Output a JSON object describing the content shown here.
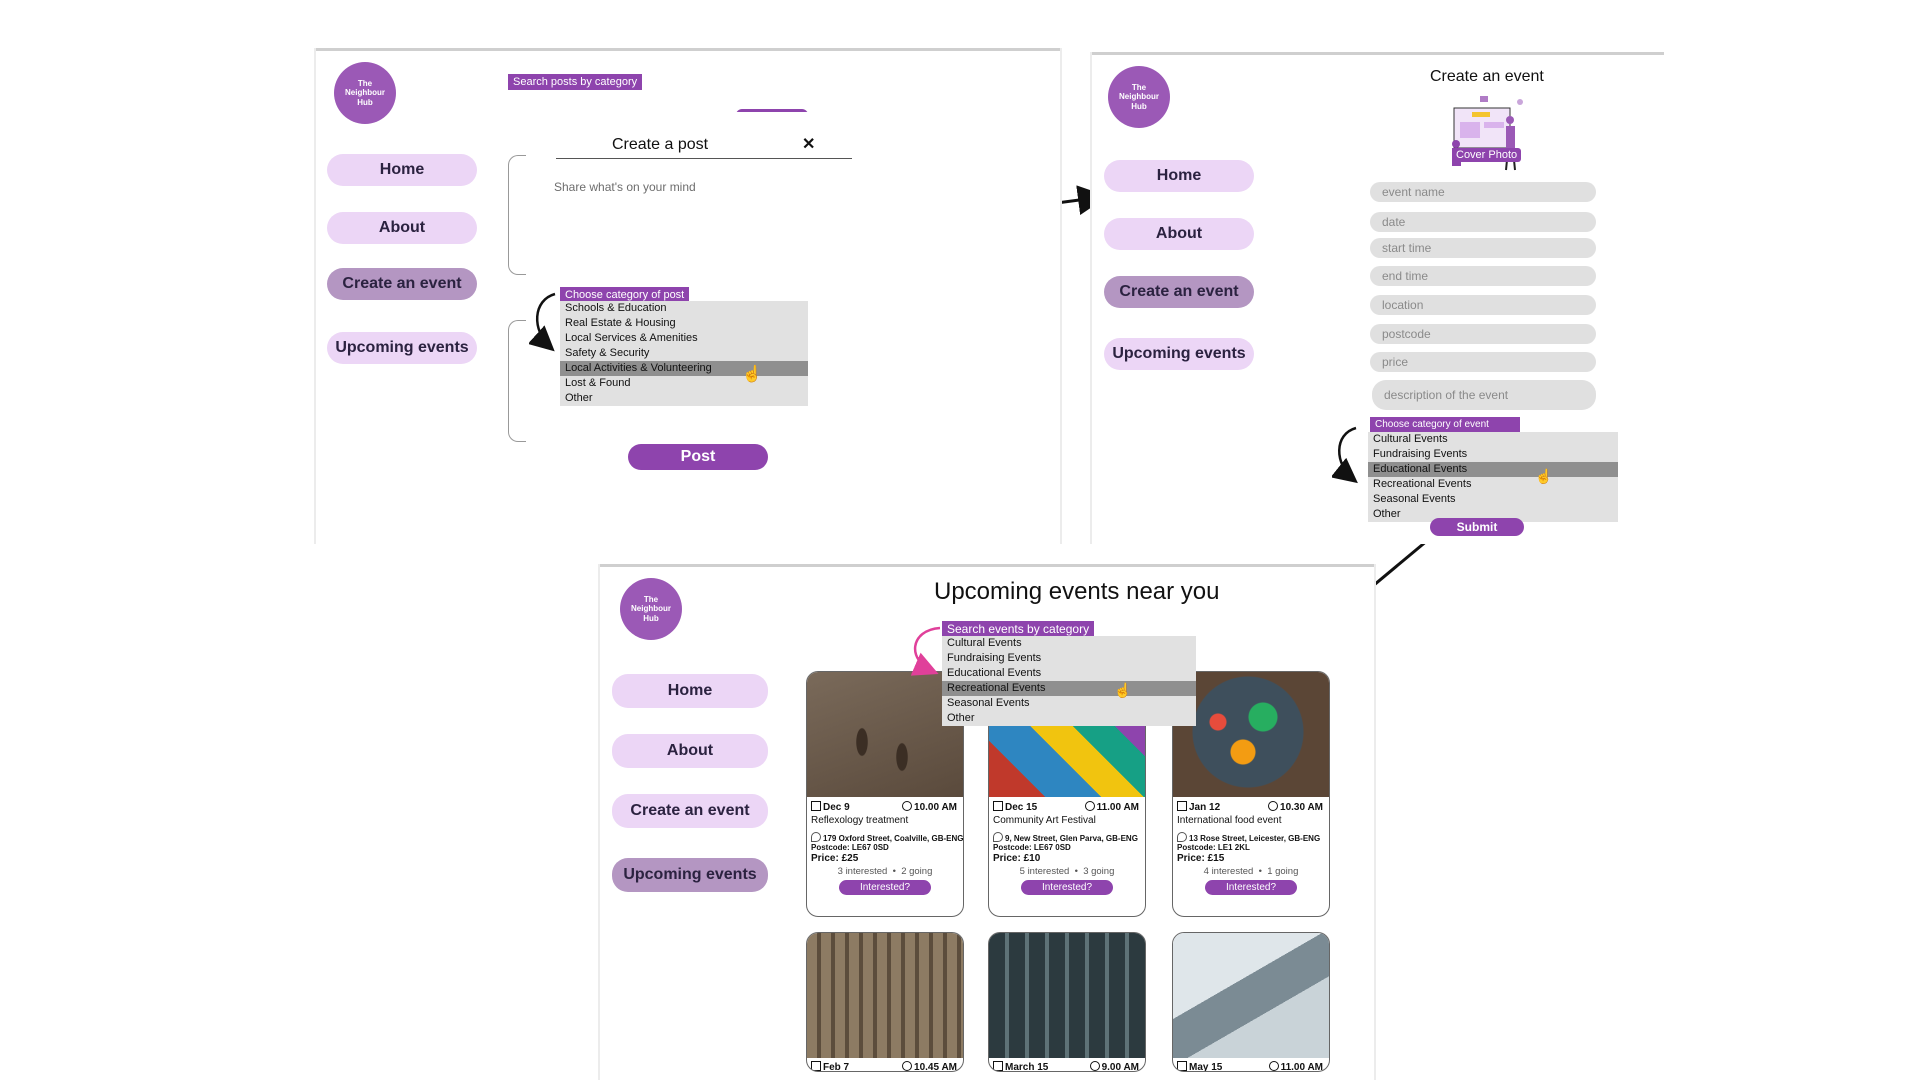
{
  "brand": {
    "logo_text": "The Neighbour Hub"
  },
  "nav": {
    "home": "Home",
    "about": "About",
    "create": "Create an event",
    "upcoming": "Upcoming events"
  },
  "panel_post": {
    "search_tag": "Search posts by category",
    "modal_title": "Create a post",
    "close": "✕",
    "placeholder": "Share what's on your mind",
    "category_label": "Choose category of post",
    "categories": [
      "Schools & Education",
      "Real Estate & Housing",
      "Local Services & Amenities",
      "Safety & Security",
      "Local Activities & Volunteering",
      "Lost & Found",
      "Other"
    ],
    "highlighted_index": 4,
    "post_button": "Post"
  },
  "panel_create": {
    "title": "Create an event",
    "cover_label": "Cover Photo",
    "fields": [
      "event name",
      "date",
      "start time",
      "end time",
      "location",
      "postcode",
      "price",
      "description of the event"
    ],
    "category_label": "Choose category of event",
    "categories": [
      "Cultural Events",
      "Fundraising Events",
      "Educational Events",
      "Recreational Events",
      "Seasonal Events",
      "Other"
    ],
    "highlighted_index": 2,
    "submit_button": "Submit"
  },
  "panel_upcoming": {
    "title": "Upcoming events near you",
    "search_tag": "Search events by category",
    "categories": [
      "Cultural Events",
      "Fundraising Events",
      "Educational Events",
      "Recreational Events",
      "Seasonal Events",
      "Other"
    ],
    "highlighted_index": 3,
    "events": [
      {
        "date": "Dec 9",
        "time": "10.00 AM",
        "title": "Reflexology treatment",
        "address": "179 Oxford Street, Coalville, GB-ENG",
        "postcode": "Postcode: LE67 0SD",
        "price": "Price: £25",
        "interested": "3 interested",
        "going": "2 going",
        "button": "Interested?"
      },
      {
        "date": "Dec 15",
        "time": "11.00 AM",
        "title": "Community Art Festival",
        "address": "9, New Street, Glen Parva, GB-ENG",
        "postcode": "Postcode: LE67 0SD",
        "price": "Price: £10",
        "interested": "5 interested",
        "going": "3 going",
        "button": "Interested?"
      },
      {
        "date": "Jan 12",
        "time": "10.30 AM",
        "title": "International food event",
        "address": "13 Rose Street, Leicester, GB-ENG",
        "postcode": "Postcode: LE1 2KL",
        "price": "Price: £15",
        "interested": "4 interested",
        "going": "1 going",
        "button": "Interested?"
      }
    ],
    "more_events": [
      {
        "date": "Feb 7",
        "time": "10.45 AM"
      },
      {
        "date": "March 15",
        "time": "9.00 AM"
      },
      {
        "date": "May 15",
        "time": "11.00 AM"
      }
    ]
  },
  "colors": {
    "accent": "#8e44ad",
    "nav_bg": "#ecd6f6",
    "nav_active": "#b496c2",
    "field_bg": "#e0e0e0",
    "dropdown_bg": "#e1e1e1",
    "dropdown_highlight": "#8f8f8f"
  }
}
